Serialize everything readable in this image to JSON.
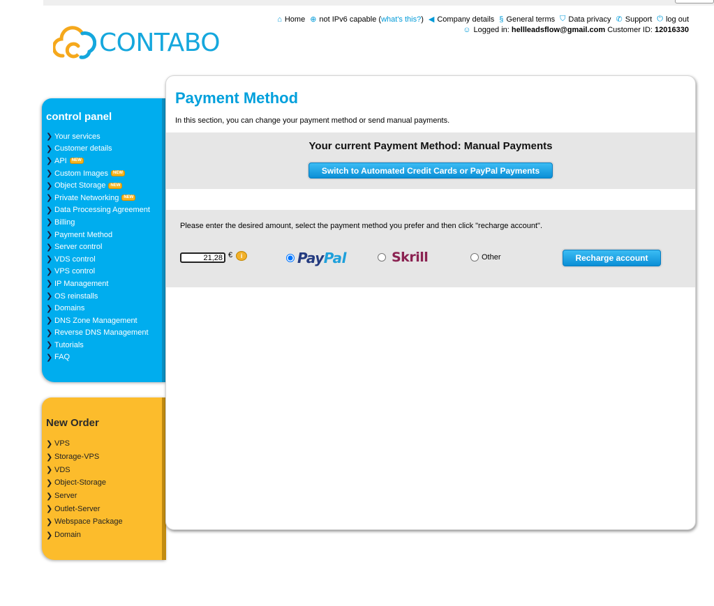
{
  "brand": {
    "name": "CONTABO",
    "color": "#15a7dd"
  },
  "topnav": {
    "home": "Home",
    "ipv6": "not IPv6 capable (",
    "ipv6_link": "what's this?",
    "ipv6_end": ")",
    "company": "Company details",
    "terms": "General terms",
    "privacy": "Data privacy",
    "support": "Support",
    "logout": "log out",
    "logged_in_label": "Logged in:",
    "email": "hellleadsflow@gmail.com",
    "customer_id_label": "Customer ID:",
    "customer_id": "12016330",
    "icons": [
      "home-icon",
      "globe-icon",
      "company-icon",
      "paragraph-icon",
      "shield-icon",
      "phone-icon",
      "power-icon",
      "user-icon"
    ]
  },
  "control_panel": {
    "title": "control panel",
    "items": [
      {
        "label": "Your services"
      },
      {
        "label": "Customer details"
      },
      {
        "label": "API",
        "badge": "NEW"
      },
      {
        "label": "Custom Images",
        "badge": "NEW"
      },
      {
        "label": "Object Storage",
        "badge": "NEW"
      },
      {
        "label": "Private Networking",
        "badge": "NEW"
      },
      {
        "label": "Data Processing Agreement"
      },
      {
        "label": "Billing"
      },
      {
        "label": "Payment Method"
      },
      {
        "label": "Server control"
      },
      {
        "label": "VDS control"
      },
      {
        "label": "VPS control"
      },
      {
        "label": "IP Management"
      },
      {
        "label": "OS reinstalls"
      },
      {
        "label": "Domains"
      },
      {
        "label": "DNS Zone Management"
      },
      {
        "label": "Reverse DNS Management"
      },
      {
        "label": "Tutorials"
      },
      {
        "label": "FAQ"
      }
    ]
  },
  "new_order": {
    "title": "New Order",
    "items": [
      {
        "label": "VPS"
      },
      {
        "label": "Storage-VPS"
      },
      {
        "label": "VDS"
      },
      {
        "label": "Object-Storage"
      },
      {
        "label": "Server"
      },
      {
        "label": "Outlet-Server"
      },
      {
        "label": "Webspace Package"
      },
      {
        "label": "Domain"
      }
    ]
  },
  "main": {
    "title": "Payment Method",
    "intro": "In this section, you can change your payment method or send manual payments.",
    "current_method": "Your current Payment Method: Manual Payments",
    "switch_button": "Switch to Automated Credit Cards or PayPal Payments",
    "instructions": "Please enter the desired amount, select the payment method you prefer and then click \"recharge account\".",
    "amount": "21,28",
    "currency": "€",
    "paypal_a": "Pay",
    "paypal_b": "Pal",
    "skrill": "Skrill",
    "other": "Other",
    "recharge_button": "Recharge account",
    "selected_method": "PayPal"
  },
  "colors": {
    "accent": "#00adee",
    "sidebar_yellow": "#fcbc2c",
    "title_blue": "#00a0dc"
  }
}
